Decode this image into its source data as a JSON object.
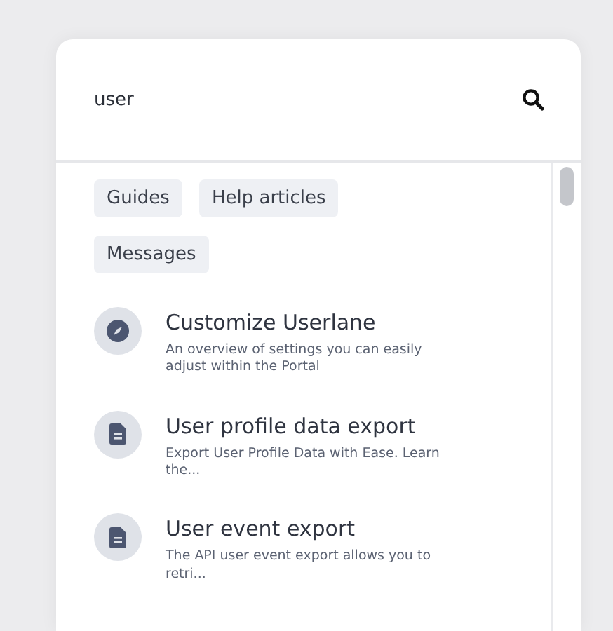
{
  "search": {
    "value": "user"
  },
  "filters": [
    {
      "label": "Guides"
    },
    {
      "label": "Help articles"
    },
    {
      "label": "Messages"
    }
  ],
  "results": [
    {
      "kind": "guide",
      "title": "Customize Userlane",
      "description": "An overview of settings you can easily adjust within the Portal"
    },
    {
      "kind": "article",
      "title": "User profile data export",
      "description": "Export User Profile Data with Ease. Learn the..."
    },
    {
      "kind": "article",
      "title": "User event export",
      "description": "The API user event export allows you to retri..."
    }
  ]
}
